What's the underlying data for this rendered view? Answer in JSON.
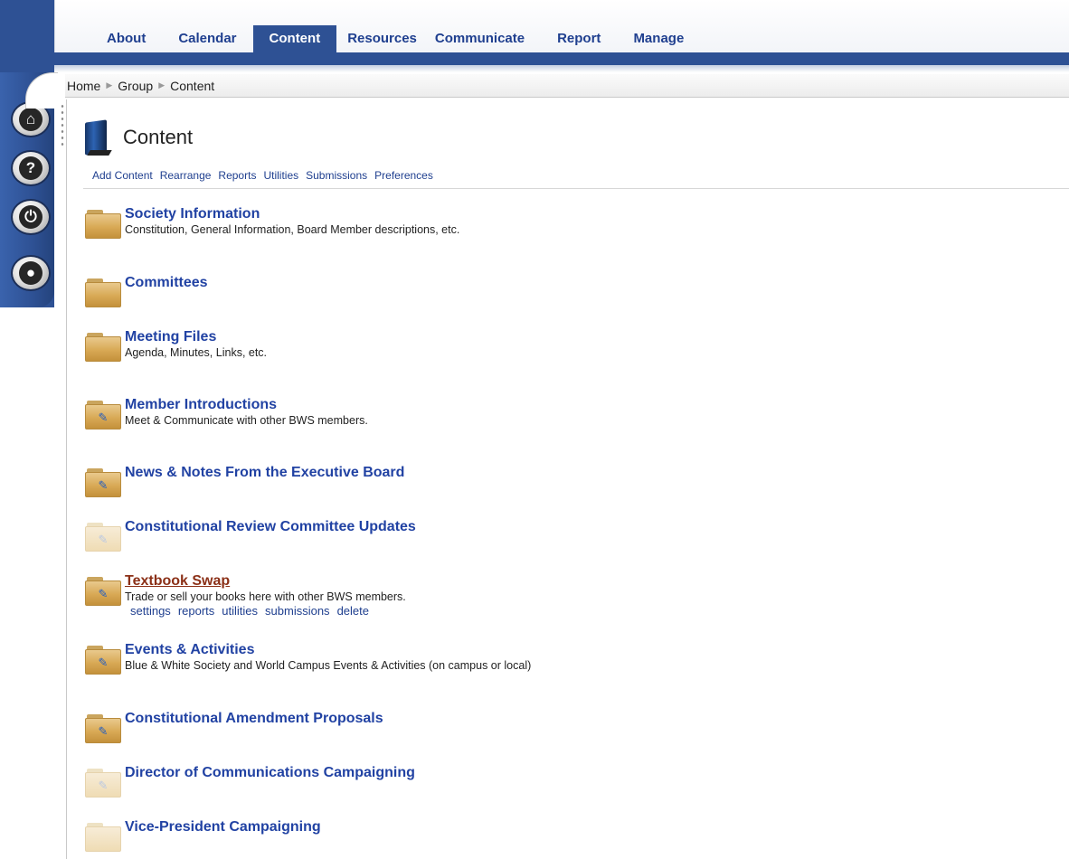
{
  "nav": {
    "items": [
      {
        "label": "About",
        "active": false
      },
      {
        "label": "Calendar",
        "active": false
      },
      {
        "label": "Content",
        "active": true
      },
      {
        "label": "Resources",
        "active": false
      },
      {
        "label": "Communicate",
        "active": false
      },
      {
        "label": "Report",
        "active": false
      },
      {
        "label": "Manage",
        "active": false
      }
    ]
  },
  "rail": {
    "icons": [
      "home-icon",
      "help-icon",
      "power-icon",
      "profile-icon"
    ]
  },
  "breadcrumb": [
    "Home",
    "Group",
    "Content"
  ],
  "page": {
    "title": "Content",
    "icon": "book-icon"
  },
  "toolbar": [
    "Add Content",
    "Rearrange",
    "Reports",
    "Utilities",
    "Submissions",
    "Preferences"
  ],
  "entries": [
    {
      "title": "Society Information",
      "description": "Constitution, General Information, Board Member descriptions, etc.",
      "folder": "plain"
    },
    {
      "title": "Committees",
      "description": "",
      "folder": "plain"
    },
    {
      "title": "Meeting Files",
      "description": "Agenda, Minutes, Links, etc.",
      "folder": "plain"
    },
    {
      "title": "Member Introductions",
      "description": "Meet & Communicate with other BWS members.",
      "folder": "pinned"
    },
    {
      "title": "News & Notes From the Executive Board",
      "description": "",
      "folder": "pinned"
    },
    {
      "title": "Constitutional Review Committee Updates",
      "description": "",
      "folder": "faded-pinned"
    },
    {
      "title": "Textbook Swap",
      "description": "Trade or sell your books here with other BWS members.",
      "folder": "pinned",
      "hovered": true,
      "actions": [
        "settings",
        "reports",
        "utilities",
        "submissions",
        "delete"
      ]
    },
    {
      "title": "Events & Activities",
      "description": "Blue & White Society and World Campus Events & Activities (on campus or local)",
      "folder": "pinned"
    },
    {
      "title": "Constitutional Amendment Proposals",
      "description": "",
      "folder": "pinned"
    },
    {
      "title": "Director of Communications Campaigning",
      "description": "",
      "folder": "faded-pinned"
    },
    {
      "title": "Vice-President Campaigning",
      "description": "",
      "folder": "faded"
    }
  ]
}
